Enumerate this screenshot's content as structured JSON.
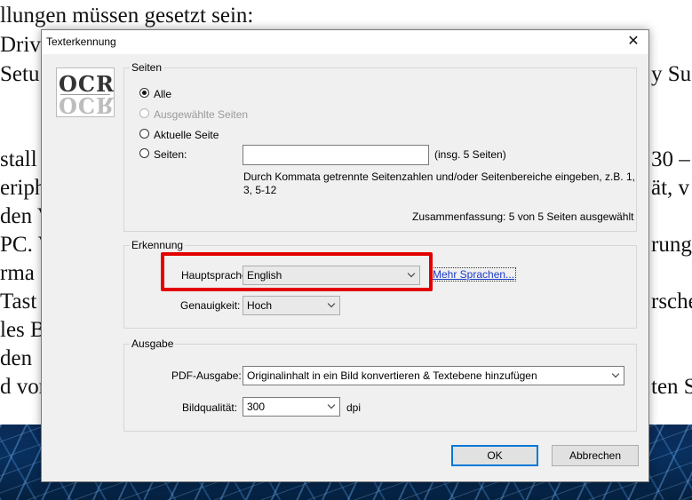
{
  "background": {
    "doc_lines": [
      "llungen müssen gesetzt sein:",
      "Driv",
      "Setu",
      "y Su",
      "stall",
      "30 –",
      "eriph",
      "ät, v",
      "den V",
      "PC. V",
      "rung",
      "rma",
      "Tast",
      "rsche",
      "les B",
      "den",
      "d vor",
      "ten S"
    ]
  },
  "dialog": {
    "title": "Texterkennung",
    "close_glyph": "✕",
    "logo": {
      "text": "OCR"
    },
    "pages": {
      "legend": "Seiten",
      "options": [
        {
          "label": "Alle",
          "checked": true,
          "disabled": false
        },
        {
          "label": "Ausgewählte Seiten",
          "checked": false,
          "disabled": true
        },
        {
          "label": "Aktuelle Seite",
          "checked": false,
          "disabled": false
        },
        {
          "label": "Seiten:",
          "checked": false,
          "disabled": false
        }
      ],
      "pages_input_value": "",
      "total_hint": "(insg. 5 Seiten)",
      "help_text_line1": "Durch Kommata getrennte Seitenzahlen und/oder Seitenbereiche eingeben, z.B. 1,",
      "help_text_line2": "3, 5-12",
      "summary": "Zusammenfassung: 5 von 5 Seiten ausgewählt"
    },
    "recognition": {
      "legend": "Erkennung",
      "language_label": "Hauptsprache:",
      "language_value": "English",
      "more_languages": "Mehr Sprachen...",
      "accuracy_label": "Genauigkeit:",
      "accuracy_value": "Hoch"
    },
    "output": {
      "legend": "Ausgabe",
      "pdf_label": "PDF-Ausgabe:",
      "pdf_value": "Originalinhalt in ein Bild konvertieren & Textebene hinzufügen",
      "quality_label": "Bildqualität:",
      "quality_value": "300",
      "quality_unit": "dpi"
    },
    "buttons": {
      "ok": "OK",
      "cancel": "Abbrechen"
    },
    "colors": {
      "highlight": "#e30000",
      "link": "#1a3bc8",
      "default_button_border": "#0078d7"
    }
  }
}
